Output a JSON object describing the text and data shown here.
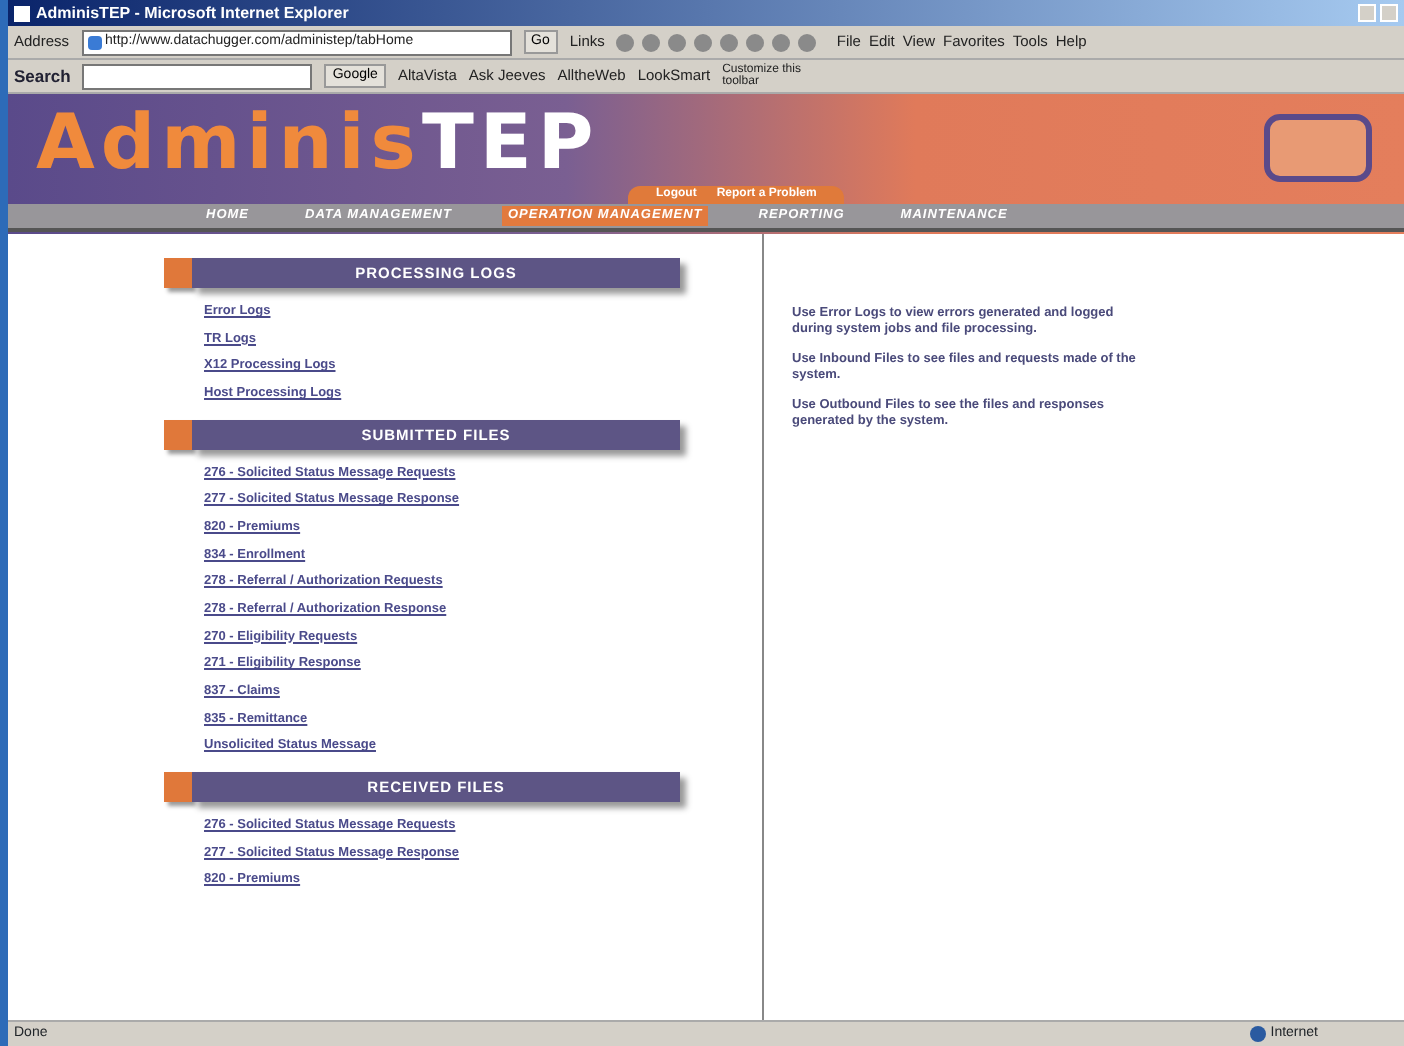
{
  "window": {
    "title": "AdminisTEP - Microsoft Internet Explorer"
  },
  "address_bar": {
    "label": "Address",
    "url": "http://www.datachugger.com/administep/tabHome",
    "go": "Go",
    "links": "Links"
  },
  "menu": [
    "File",
    "Edit",
    "View",
    "Favorites",
    "Tools",
    "Help"
  ],
  "search_toolbar": {
    "label": "Search",
    "engine": "Google",
    "engines": [
      "AltaVista",
      "Ask Jeeves",
      "AlltheWeb",
      "LookSmart"
    ],
    "customize": "Customize this toolbar"
  },
  "banner": {
    "logo_orange": "Adminis",
    "logo_white": "TEP",
    "utility_links": [
      "Logout",
      "Report a Problem"
    ]
  },
  "nav": [
    {
      "label": "HOME",
      "selected": false
    },
    {
      "label": "DATA MANAGEMENT",
      "selected": false
    },
    {
      "label": "OPERATION MANAGEMENT",
      "selected": true
    },
    {
      "label": "REPORTING",
      "selected": false
    },
    {
      "label": "MAINTENANCE",
      "selected": false
    }
  ],
  "sections": [
    {
      "title": "PROCESSING LOGS",
      "links": [
        "Error Logs",
        "TR Logs",
        "X12 Processing Logs",
        "Host Processing Logs"
      ]
    },
    {
      "title": "SUBMITTED FILES",
      "links": [
        "276 - Solicited Status Message Requests",
        "277 - Solicited Status Message Response",
        "820 - Premiums",
        "834 - Enrollment",
        "278 - Referral / Authorization Requests",
        "278 - Referral / Authorization Response",
        "270 - Eligibility Requests",
        "271 - Eligibility Response",
        "837 - Claims",
        "835 - Remittance",
        "Unsolicited Status Message"
      ]
    },
    {
      "title": "RECEIVED FILES",
      "links": [
        "276 - Solicited Status Message Requests",
        "277 - Solicited Status Message Response",
        "820 - Premiums"
      ]
    }
  ],
  "help": [
    "Use Error Logs to view errors generated and logged during system jobs and file processing.",
    "Use Inbound Files to see files and requests made of the system.",
    "Use Outbound Files to see the files and responses generated by the system."
  ],
  "status_bar": {
    "text": "Done",
    "zone": "Internet"
  }
}
